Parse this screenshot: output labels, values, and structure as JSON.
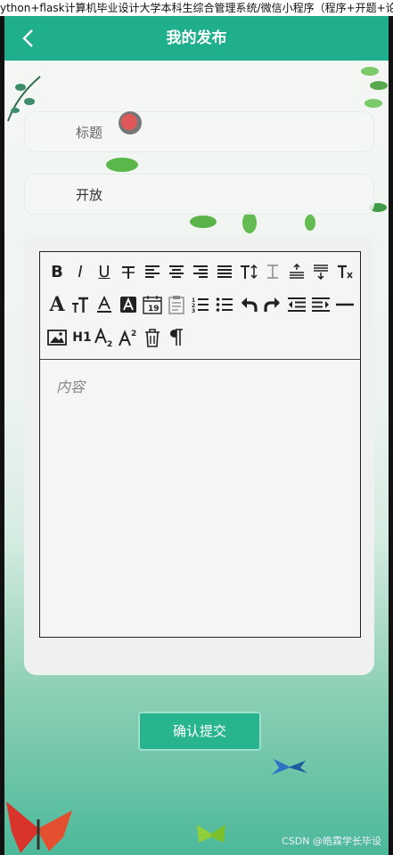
{
  "top_strip": {
    "text": "ython+flask计算机毕业设计大学本科生综合管理系统/微信小程序（程序+开题+论文）..."
  },
  "header": {
    "title": "我的发布"
  },
  "form": {
    "title_placeholder": "标题",
    "status_value": "开放",
    "content_placeholder": "内容"
  },
  "toolbar": {
    "row1": [
      "bold",
      "italic",
      "underline",
      "strikethrough",
      "align-left",
      "align-center",
      "align-right",
      "align-justify",
      "line-height",
      "text-indent",
      "paragraph-spacing-before",
      "paragraph-spacing-after",
      "clear-format"
    ],
    "row2": [
      "font-family",
      "font-size",
      "font-color",
      "background-color",
      "date",
      "clipboard",
      "ordered-list",
      "unordered-list",
      "undo",
      "redo",
      "outdent",
      "indent",
      "horizontal-rule"
    ],
    "row3": [
      "image",
      "header",
      "subscript",
      "superscript",
      "delete",
      "paragraph"
    ],
    "h1_label": "H1"
  },
  "submit": {
    "label": "确认提交"
  },
  "watermark": "CSDN @皓霖学长毕设",
  "colors": {
    "header": "#1faf8c",
    "button": "#28b48f"
  }
}
